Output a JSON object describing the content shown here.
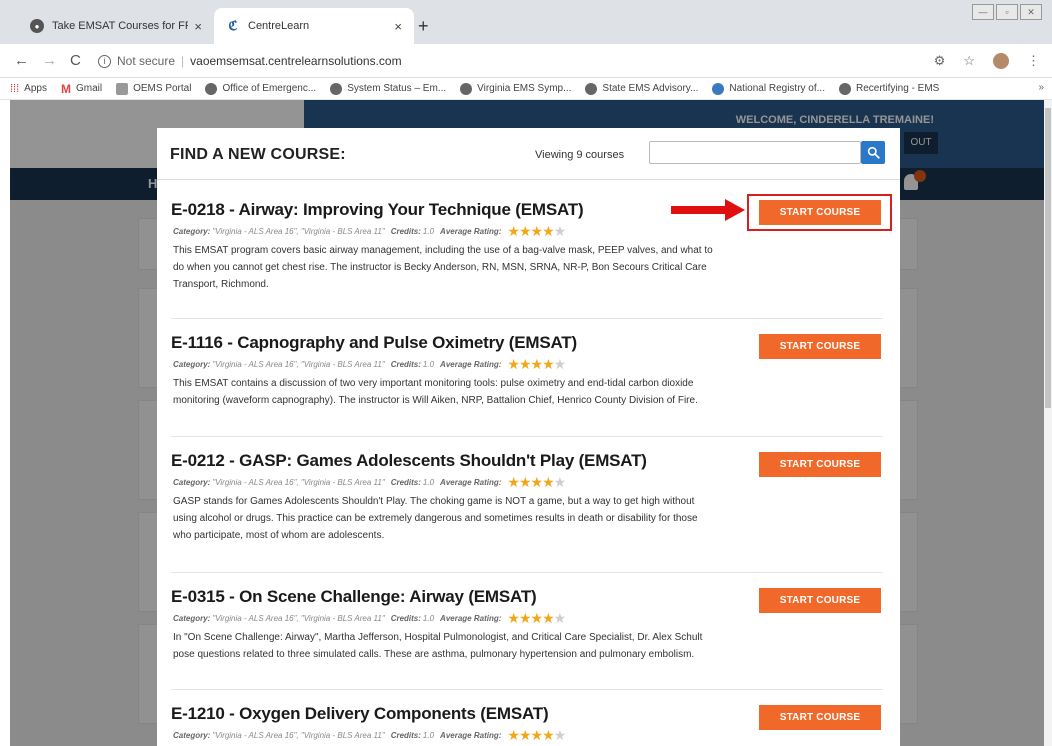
{
  "browser": {
    "tabs": [
      {
        "title": "Take EMSAT Courses for FREE on",
        "close": "×"
      },
      {
        "title": "CentreLearn",
        "close": "×"
      }
    ],
    "new_tab": "+",
    "nav": {
      "back": "←",
      "forward": "→",
      "reload": "C"
    },
    "address": {
      "security": "Not secure",
      "url": "vaoemsemsat.centrelearnsolutions.com"
    },
    "bookmarks": [
      "Apps",
      "Gmail",
      "OEMS Portal",
      "Office of Emergenc...",
      "System Status – Em...",
      "Virginia EMS Symp...",
      "State EMS Advisory...",
      "National Registry of...",
      "Recertifying - EMS"
    ],
    "bookmarks_more": "»"
  },
  "background_page": {
    "welcome": "WELCOME, CINDERELLA TREMAINE!",
    "logout": "OUT",
    "nav_letter": "H"
  },
  "modal": {
    "title": "FIND A NEW COURSE:",
    "viewing": "Viewing 9 courses",
    "search": {
      "value": "",
      "placeholder": ""
    },
    "start_label": "START COURSE",
    "meta_labels": {
      "category": "Category:",
      "credits": "Credits:",
      "rating": "Average Rating:"
    },
    "courses": [
      {
        "name": "E-0218 - Airway: Improving Your Technique (EMSAT)",
        "category": "\"Virginia - ALS Area 16\", \"Virginia - BLS Area 11\"",
        "credits": "1.0",
        "rating": 4,
        "description": "This EMSAT program covers basic airway management, including the use of a bag-valve mask, PEEP valves, and what to do when you cannot get chest rise. The instructor is Becky Anderson, RN, MSN, SRNA, NR-P, Bon Secours Critical Care Transport, Richmond."
      },
      {
        "name": "E-1116 - Capnography and Pulse Oximetry (EMSAT)",
        "category": "\"Virginia - ALS Area 16\", \"Virginia - BLS Area 11\"",
        "credits": "1.0",
        "rating": 4,
        "description": "This EMSAT contains a discussion of two very important monitoring tools: pulse oximetry and end-tidal carbon dioxide monitoring (waveform capnography). The instructor is Will Aiken, NRP, Battalion Chief, Henrico County Division of Fire."
      },
      {
        "name": "E-0212 - GASP: Games Adolescents Shouldn't Play (EMSAT)",
        "category": "\"Virginia - ALS Area 16\", \"Virginia - BLS Area 11\"",
        "credits": "1.0",
        "rating": 4,
        "description": "GASP stands for Games Adolescents Shouldn't Play. The choking game is NOT a game, but a way to get high without using alcohol or drugs. This practice can be extremely dangerous and sometimes results in death or disability for those who participate, most of whom are adolescents."
      },
      {
        "name": "E-0315 - On Scene Challenge: Airway (EMSAT)",
        "category": "\"Virginia - ALS Area 16\", \"Virginia - BLS Area 11\"",
        "credits": "1.0",
        "rating": 4,
        "description": "In \"On Scene Challenge: Airway\", Martha Jefferson, Hospital Pulmonologist, and Critical Care Specialist, Dr. Alex Schult pose questions related to three simulated calls. These are asthma, pulmonary hypertension and pulmonary embolism."
      },
      {
        "name": "E-1210 - Oxygen Delivery Components (EMSAT)",
        "category": "\"Virginia - ALS Area 16\", \"Virginia - BLS Area 11\"",
        "credits": "1.0",
        "rating": 4,
        "description": ""
      }
    ]
  },
  "colors": {
    "start_button": "#f0692a",
    "highlight": "#d61f1f",
    "search_button": "#2a78c8",
    "star_on": "#f2a71a",
    "star_off": "#cfcfcf"
  }
}
